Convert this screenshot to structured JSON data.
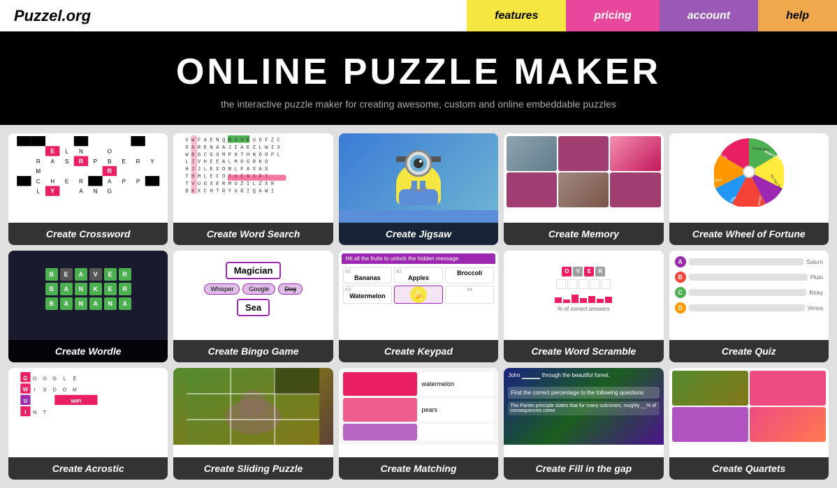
{
  "header": {
    "logo": "Puzzel.org",
    "nav": [
      {
        "id": "features",
        "label": "features",
        "class": "nav-features"
      },
      {
        "id": "pricing",
        "label": "pricing",
        "class": "nav-pricing"
      },
      {
        "id": "account",
        "label": "account",
        "class": "nav-account"
      },
      {
        "id": "help",
        "label": "help",
        "class": "nav-help"
      }
    ]
  },
  "hero": {
    "title": "ONLINE PUZZLE MAKER",
    "subtitle": "the interactive puzzle maker for creating awesome, custom and online embeddable puzzles"
  },
  "puzzles": [
    {
      "id": "crossword",
      "label": "Create Crossword"
    },
    {
      "id": "wordsearch",
      "label": "Create Word Search"
    },
    {
      "id": "jigsaw",
      "label": "Create Jigsaw"
    },
    {
      "id": "memory",
      "label": "Create Memory"
    },
    {
      "id": "wheeloffortune",
      "label": "Create Wheel of Fortune"
    },
    {
      "id": "wordle",
      "label": "Create Wordle"
    },
    {
      "id": "bingo",
      "label": "Create Bingo Game"
    },
    {
      "id": "keypad",
      "label": "Create Keypad"
    },
    {
      "id": "wordscramble",
      "label": "Create Word Scramble"
    },
    {
      "id": "quiz",
      "label": "Create Quiz"
    },
    {
      "id": "acrostic",
      "label": "Create Acrostic"
    },
    {
      "id": "sliding",
      "label": "Create Sliding Puzzle"
    },
    {
      "id": "matching",
      "label": "Create Matching"
    },
    {
      "id": "fillgap",
      "label": "Create Fill in the gap"
    },
    {
      "id": "quartets",
      "label": "Create Quartets"
    }
  ]
}
